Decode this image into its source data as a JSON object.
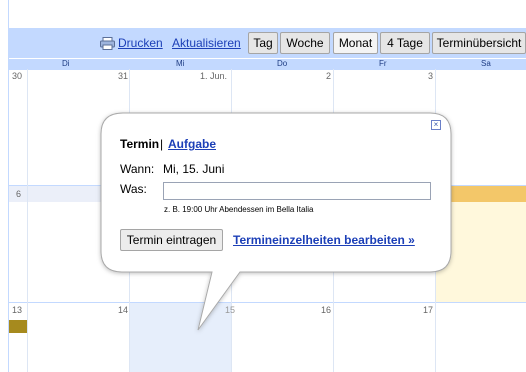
{
  "toolbar": {
    "print_label": "Drucken",
    "refresh_label": "Aktualisieren",
    "views": [
      "Tag",
      "Woche",
      "Monat",
      "4 Tage",
      "Terminübersicht"
    ],
    "selected_view": "Monat"
  },
  "day_names": [
    "Di",
    "Mi",
    "Do",
    "Fr",
    "Sa"
  ],
  "weeks": [
    [
      "30",
      "31",
      "1. Jun.",
      "2",
      "3"
    ],
    [
      "6"
    ],
    [
      "13",
      "14",
      "15",
      "16",
      "17"
    ]
  ],
  "bubble": {
    "tab_event": "Termin",
    "tab_separator": "|",
    "tab_task": "Aufgabe",
    "when_label": "Wann:",
    "when_value": "Mi, 15. Juni",
    "what_label": "Was:",
    "what_value": "",
    "what_hint": "z. B. 19:00 Uhr Abendessen im Bella Italia",
    "create_button": "Termin eintragen",
    "edit_details_link": "Termineinzelheiten bearbeiten »",
    "close_glyph": "×"
  },
  "colors": {
    "toolbar_bg": "#c3d9ff",
    "link": "#1c3fb7",
    "saturday_event": "#f3c769",
    "today_highlight": "#e6eefb",
    "event_chip": "#a68a1e"
  },
  "icons": {
    "print": "printer-icon",
    "close": "close-icon"
  }
}
